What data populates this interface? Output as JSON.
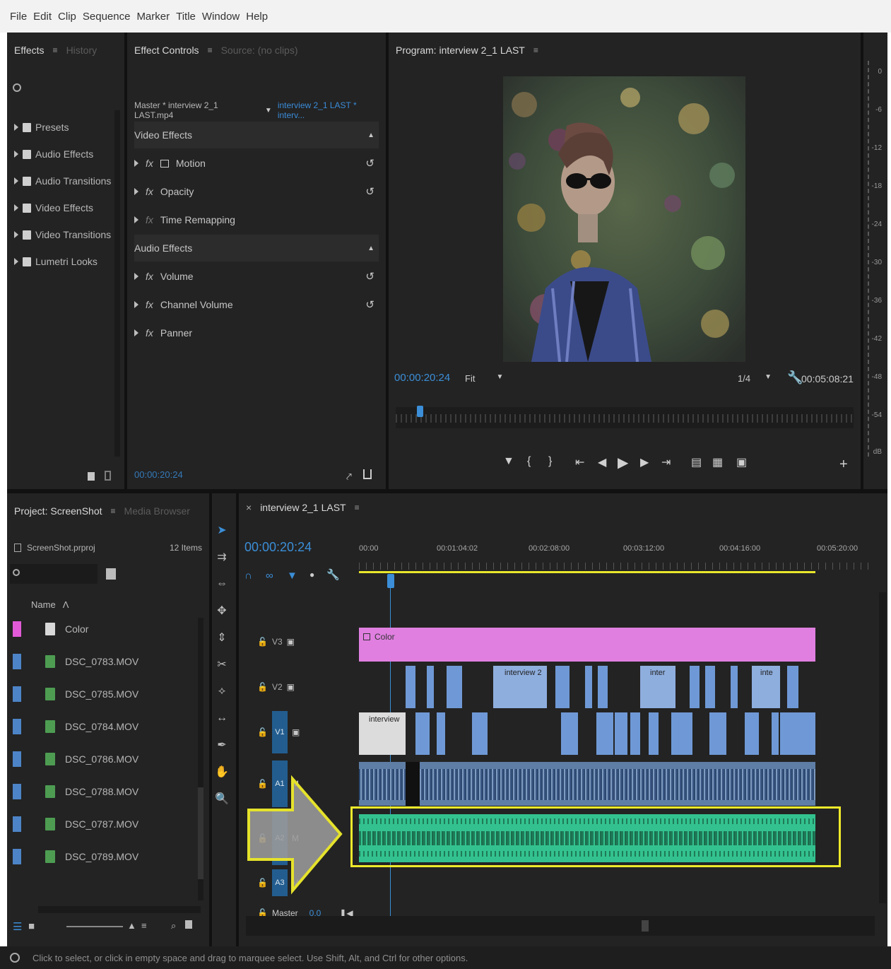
{
  "menu": [
    "File",
    "Edit",
    "Clip",
    "Sequence",
    "Marker",
    "Title",
    "Window",
    "Help"
  ],
  "effects_panel": {
    "tab_active": "Effects",
    "tab_menu": "≡",
    "tab_inactive": "History",
    "items": [
      "Presets",
      "Audio Effects",
      "Audio Transitions",
      "Video Effects",
      "Video Transitions",
      "Lumetri Looks"
    ]
  },
  "effect_controls": {
    "tab_active": "Effect Controls",
    "tab_menu": "≡",
    "tab_inactive": "Source: (no clips)",
    "source_label": "Master * interview 2_1 LAST.mp4",
    "sequence_label": "interview 2_1 LAST * interv...",
    "video_section": "Video Effects",
    "video_effects": [
      "Motion",
      "Opacity",
      "Time Remapping"
    ],
    "audio_section": "Audio Effects",
    "audio_effects": [
      "Volume",
      "Channel Volume",
      "Panner"
    ],
    "timecode": "00:00:20:24"
  },
  "program_monitor": {
    "title": "Program: interview 2_1 LAST",
    "title_menu": "≡",
    "timecode": "00:00:20:24",
    "fit": "Fit",
    "quality": "1/4",
    "duration": "00:05:08:21",
    "meter_labels": [
      "0",
      "-6",
      "-12",
      "-18",
      "-24",
      "-30",
      "-36",
      "-42",
      "-48",
      "-54",
      "dB"
    ]
  },
  "project_panel": {
    "title": "Project: ScreenShot",
    "title_menu": "≡",
    "tab_inactive": "Media Browser",
    "file": "ScreenShot.prproj",
    "count": "12 Items",
    "col_name": "Name",
    "items": [
      {
        "name": "Color",
        "color": "#e25ad8"
      },
      {
        "name": "DSC_0783.MOV",
        "color": "#4d84c7"
      },
      {
        "name": "DSC_0785.MOV",
        "color": "#4d84c7"
      },
      {
        "name": "DSC_0784.MOV",
        "color": "#4d84c7"
      },
      {
        "name": "DSC_0786.MOV",
        "color": "#4d84c7"
      },
      {
        "name": "DSC_0788.MOV",
        "color": "#4d84c7"
      },
      {
        "name": "DSC_0787.MOV",
        "color": "#4d84c7"
      },
      {
        "name": "DSC_0789.MOV",
        "color": "#4d84c7"
      }
    ]
  },
  "timeline": {
    "tab": "interview 2_1 LAST",
    "tab_menu": "≡",
    "timecode": "00:00:20:24",
    "ruler": [
      "00:00",
      "00:01:04:02",
      "00:02:08:00",
      "00:03:12:00",
      "00:04:16:00",
      "00:05:20:00"
    ],
    "tracks": {
      "v3": "V3",
      "v2": "V2",
      "v1": "V1",
      "a1": "A1",
      "a2": "A2",
      "a3": "A3",
      "master": "Master",
      "master_val": "0.0"
    },
    "clips": {
      "color": "Color",
      "interview": "interview",
      "interview2": "interview 2",
      "inter": "inter",
      "inte": "inte"
    }
  },
  "status": "Click to select, or click in empty space and drag to marquee select. Use Shift, Alt, and Ctrl for other options."
}
